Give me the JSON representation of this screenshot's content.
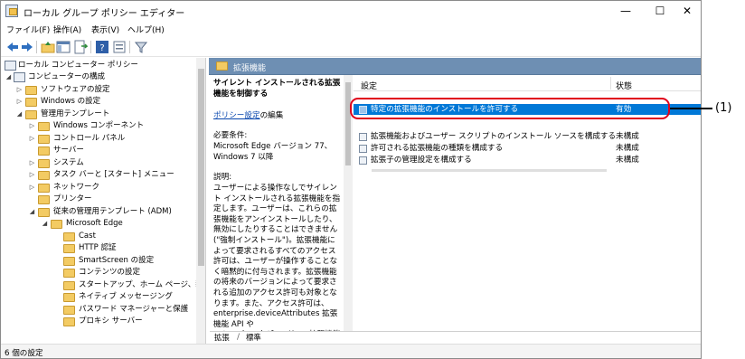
{
  "window": {
    "title": "ローカル グループ ポリシー エディター"
  },
  "menu": [
    "ファイル(F)",
    "操作(A)",
    "表示(V)",
    "ヘルプ(H)"
  ],
  "toolbar_icons": [
    "back-arrow-icon",
    "forward-arrow-icon",
    "folder-up-icon",
    "show-hide-tree-icon",
    "export-list-icon",
    "help-icon",
    "properties-icon",
    "filter-icon"
  ],
  "tree": {
    "root": "ローカル コンピューター ポリシー",
    "computer_config": "コンピューターの構成",
    "software_settings": "ソフトウェアの設定",
    "windows_settings": "Windows の設定",
    "admin_templates": "管理用テンプレート",
    "windows_components": "Windows コンポーネント",
    "control_panel": "コントロール パネル",
    "server": "サーバー",
    "system": "システム",
    "taskbar": "タスク バーと [スタート] メニュー",
    "network": "ネットワーク",
    "printers": "プリンター",
    "classic_admin": "従来の管理用テンプレート (ADM)",
    "edge": "Microsoft Edge",
    "cast": "Cast",
    "http_auth": "HTTP 認証",
    "smartscreen": "SmartScreen の設定",
    "content_settings": "コンテンツの設定",
    "startup": "スタートアップ、ホーム ページ、新しい",
    "native_messaging": "ネイティブ メッセージング",
    "password_manager": "パスワード マネージャーと保護",
    "proxy_server": "プロキシ サーバー"
  },
  "pane_header": "拡張機能",
  "description": {
    "title": "サイレント インストールされる拡張機能を制御する",
    "edit_link": "ポリシー設定",
    "edit_suffix": "の編集",
    "req_label": "必要条件:",
    "req_text": "Microsoft Edge バージョン 77、Windows 7 以降",
    "expl_label": "説明:",
    "expl_text": "ユーザーによる操作なしでサイレント インストールされる拡張機能を指定します。ユーザーは、これらの拡張機能をアンインストールしたり、無効にしたりすることはできません (\"強制インストール\")。拡張機能によって要求されるすべてのアクセス許可は、ユーザーが操作することなく暗黙的に付与されます。拡張機能の将来のバージョンによって要求される追加のアクセス許可も対象となります。また、アクセス許可は、enterprise.deviceAttributes 拡張機能 API や enterprise.platformKeys 拡張機能 API に対しても付与されます"
  },
  "list": {
    "col_setting": "設定",
    "col_state": "状態",
    "rows": [
      {
        "name": "特定の拡張機能のインストールを許可する",
        "state": "有効",
        "selected": true
      },
      {
        "name": "拡張機能およびユーザー スクリプトのインストール ソースを構成する",
        "state": "未構成"
      },
      {
        "name": "許可される拡張機能の種類を構成する",
        "state": "未構成"
      },
      {
        "name": "拡張子の管理設定を構成する",
        "state": "未構成"
      }
    ]
  },
  "tabs": {
    "extended": "拡張",
    "standard": "標準"
  },
  "status": "6 個の設定",
  "annotation": {
    "label": "(1)",
    "color": "#e0001b"
  },
  "colors": {
    "selection": "#0078d7",
    "header_bar": "#6e8fb3",
    "link": "#0645ad"
  }
}
